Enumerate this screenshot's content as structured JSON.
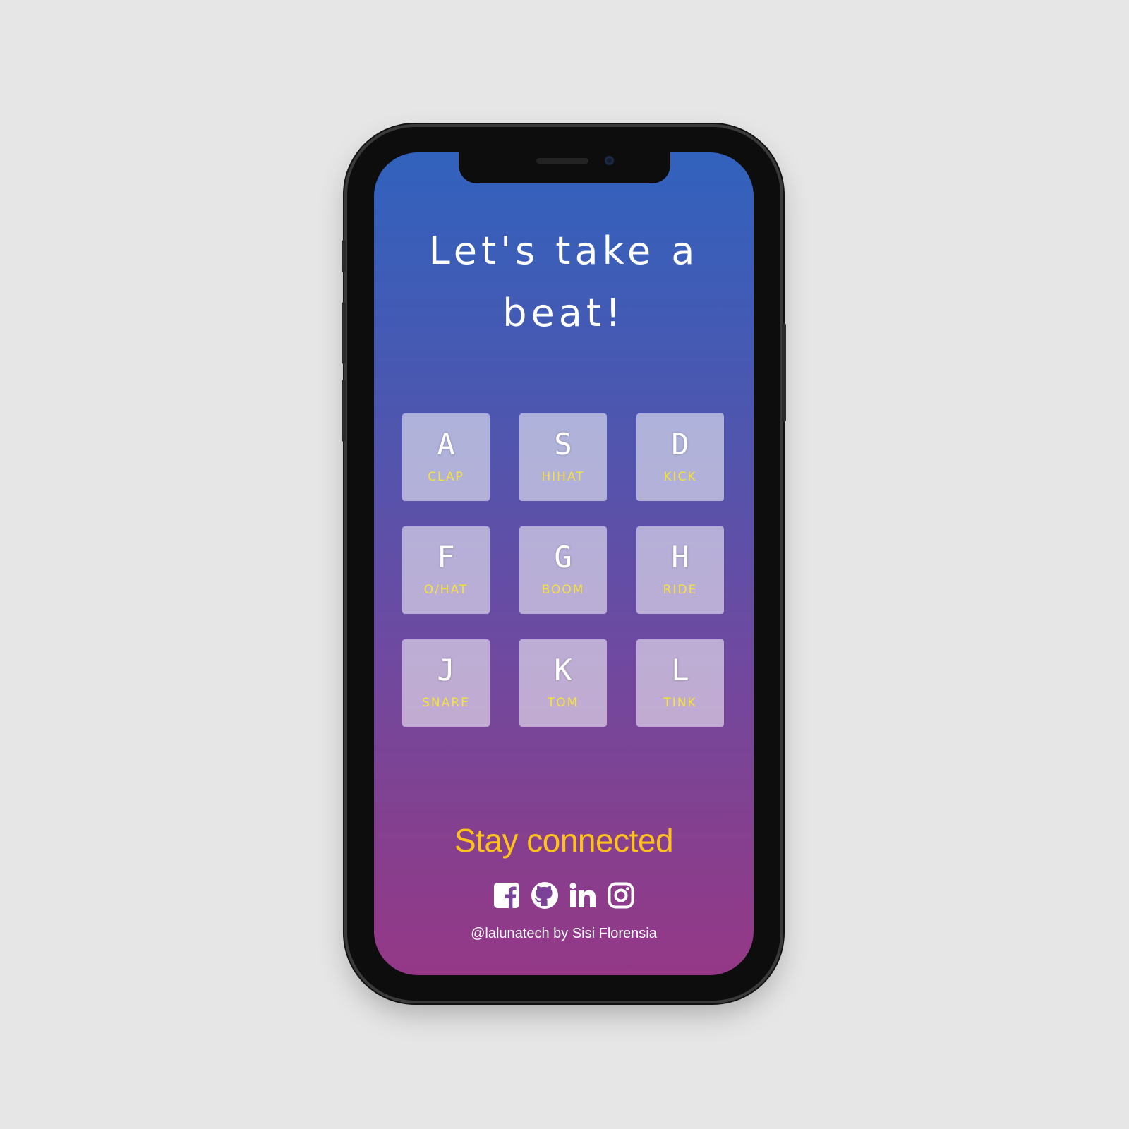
{
  "app": {
    "title": "Let's take a beat!"
  },
  "keys": [
    {
      "letter": "A",
      "sound": "CLAP"
    },
    {
      "letter": "S",
      "sound": "HIHAT"
    },
    {
      "letter": "D",
      "sound": "KICK"
    },
    {
      "letter": "F",
      "sound": "O/HAT"
    },
    {
      "letter": "G",
      "sound": "BOOM"
    },
    {
      "letter": "H",
      "sound": "RIDE"
    },
    {
      "letter": "J",
      "sound": "SNARE"
    },
    {
      "letter": "K",
      "sound": "TOM"
    },
    {
      "letter": "L",
      "sound": "TINK"
    }
  ],
  "footer": {
    "heading": "Stay connected",
    "socials": [
      {
        "icon": "facebook-icon"
      },
      {
        "icon": "github-icon"
      },
      {
        "icon": "linkedin-icon"
      },
      {
        "icon": "instagram-icon"
      }
    ],
    "credit": "@lalunatech by Sisi Florensia"
  },
  "colors": {
    "gradient_top": "#3162bd",
    "gradient_bottom": "#943887",
    "key_label": "#f5e23a",
    "heading_accent": "#ffc21a"
  }
}
